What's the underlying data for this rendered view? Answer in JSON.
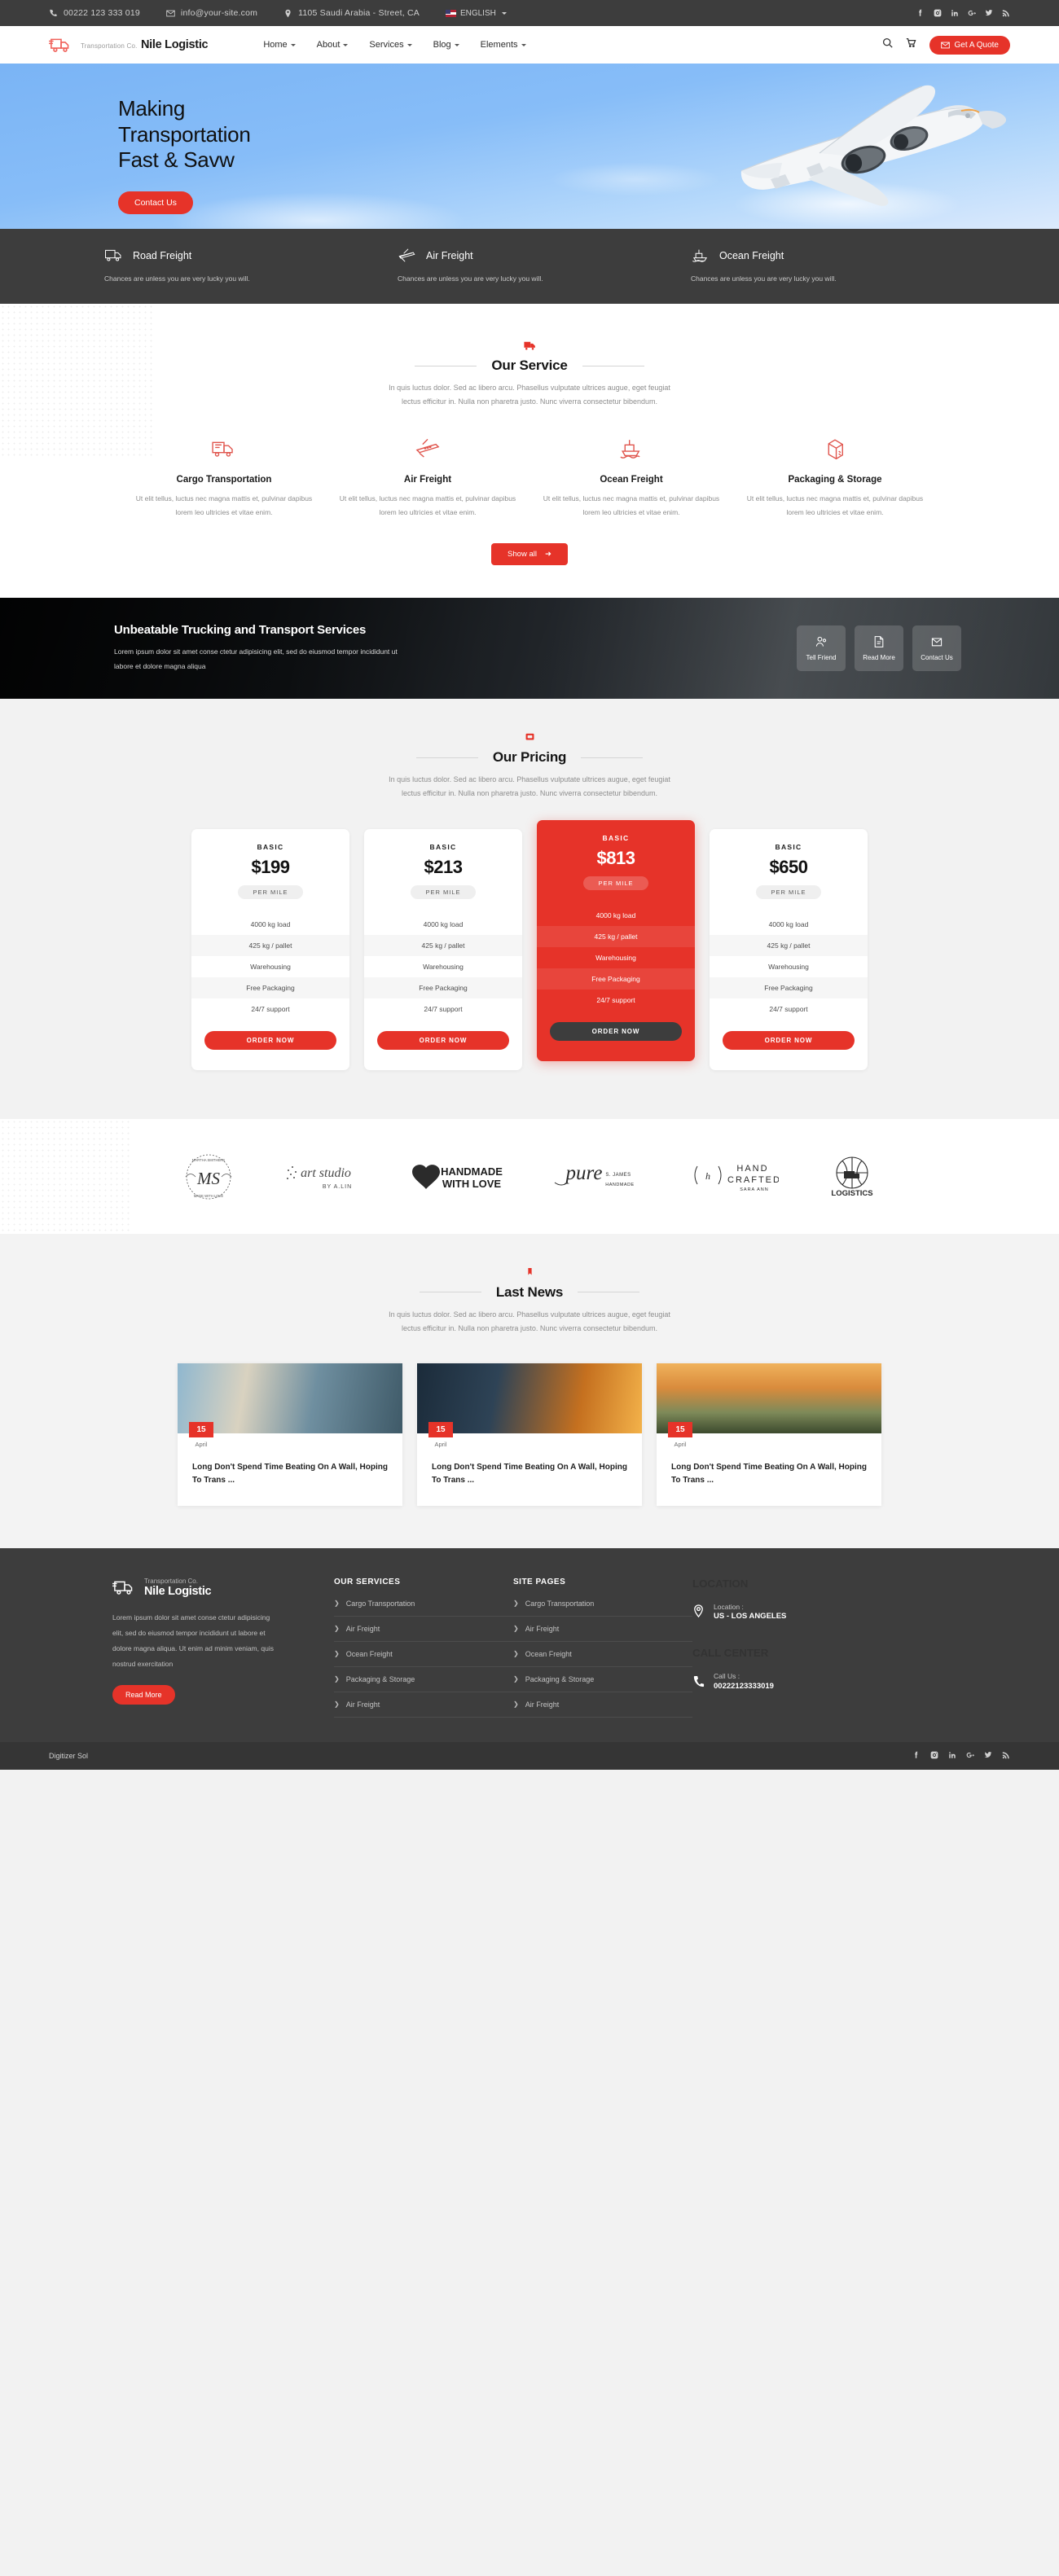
{
  "topbar": {
    "phone": "00222 123 333 019",
    "email": "info@your-site.com",
    "address": "1105 Saudi Arabia - Street, CA",
    "language": "ENGLISH"
  },
  "header": {
    "brand_sub": "Transportation Co.",
    "brand_name": "Nile Logistic",
    "nav": [
      {
        "label": "Home"
      },
      {
        "label": "About"
      },
      {
        "label": "Services"
      },
      {
        "label": "Blog"
      },
      {
        "label": "Elements"
      }
    ],
    "quote_button": "Get A Quote"
  },
  "hero": {
    "title_line1": "Making",
    "title_line2": "Transportation",
    "title_line3": "Fast & Savw",
    "button": "Contact Us"
  },
  "freight": [
    {
      "title": "Road Freight",
      "text": "Chances are unless you are very lucky you will.",
      "icon": "truck-icon"
    },
    {
      "title": "Air Freight",
      "text": "Chances are unless you are very lucky you will.",
      "icon": "plane-icon"
    },
    {
      "title": "Ocean Freight",
      "text": "Chances are unless you are very lucky you will.",
      "icon": "ship-icon"
    }
  ],
  "services_section": {
    "title": "Our Service",
    "subtitle_line1": "In quis luctus dolor. Sed ac libero arcu. Phasellus vulputate ultrices augue, eget feugiat",
    "subtitle_line2": "lectus efficitur in. Nulla non pharetra justo. Nunc viverra consectetur bibendum.",
    "show_all": "Show all",
    "items": [
      {
        "title": "Cargo Transportation",
        "text": "Ut elit tellus, luctus nec magna mattis et, pulvinar dapibus lorem leo ultricies et vitae enim.",
        "icon": "truck-icon"
      },
      {
        "title": "Air Freight",
        "text": "Ut elit tellus, luctus nec magna mattis et, pulvinar dapibus lorem leo ultricies et vitae enim.",
        "icon": "plane-icon"
      },
      {
        "title": "Ocean Freight",
        "text": "Ut elit tellus, luctus nec magna mattis et, pulvinar dapibus lorem leo ultricies et vitae enim.",
        "icon": "ship-icon"
      },
      {
        "title": "Packaging & Storage",
        "text": "Ut elit tellus, luctus nec magna mattis et, pulvinar dapibus lorem leo ultricies et vitae enim.",
        "icon": "box-icon"
      }
    ]
  },
  "cta": {
    "title": "Unbeatable Trucking and Transport Services",
    "text_line1": "Lorem ipsum dolor sit amet conse ctetur adipisicing elit, sed do eiusmod tempor incididunt ut",
    "text_line2": "labore et dolore magna aliqua",
    "boxes": [
      {
        "label": "Tell Friend",
        "icon": "users-icon"
      },
      {
        "label": "Read More",
        "icon": "document-icon"
      },
      {
        "label": "Contact Us",
        "icon": "envelope-icon"
      }
    ]
  },
  "pricing_section": {
    "title": "Our Pricing",
    "subtitle_line1": "In quis luctus dolor. Sed ac libero arcu. Phasellus vulputate ultrices augue, eget feugiat",
    "subtitle_line2": "lectus efficitur in. Nulla non pharetra justo. Nunc viverra consectetur bibendum.",
    "cards": [
      {
        "plan": "BASIC",
        "price": "$199",
        "per": "PER MILE",
        "features": [
          "4000 kg load",
          "425 kg / pallet",
          "Warehousing",
          "Free Packaging",
          "24/7 support"
        ],
        "button": "ORDER NOW",
        "featured": false
      },
      {
        "plan": "BASIC",
        "price": "$213",
        "per": "PER MILE",
        "features": [
          "4000 kg load",
          "425 kg / pallet",
          "Warehousing",
          "Free Packaging",
          "24/7 support"
        ],
        "button": "ORDER NOW",
        "featured": false
      },
      {
        "plan": "BASIC",
        "price": "$813",
        "per": "PER MILE",
        "features": [
          "4000 kg load",
          "425 kg / pallet",
          "Warehousing",
          "Free Packaging",
          "24/7 support"
        ],
        "button": "ORDER NOW",
        "featured": true
      },
      {
        "plan": "BASIC",
        "price": "$650",
        "per": "PER MILE",
        "features": [
          "4000 kg load",
          "425 kg / pallet",
          "Warehousing",
          "Free Packaging",
          "24/7 support"
        ],
        "button": "ORDER NOW",
        "featured": false
      }
    ]
  },
  "brands": [
    {
      "name": "MS Martha Smithers Made With Love"
    },
    {
      "name": "art studio BY A.LIN"
    },
    {
      "name": "HANDMADE WITH LOVE"
    },
    {
      "name": "pure S. JAMES HANDMADE"
    },
    {
      "name": "HAND CRAFTED SARA ANN"
    },
    {
      "name": "LOGISTICS"
    }
  ],
  "news_section": {
    "title": "Last News",
    "subtitle_line1": "In quis luctus dolor. Sed ac libero arcu. Phasellus vulputate ultrices augue, eget feugiat",
    "subtitle_line2": "lectus efficitur in. Nulla non pharetra justo. Nunc viverra consectetur bibendum.",
    "cards": [
      {
        "day": "15",
        "month": "April",
        "title": "Long Don't Spend Time Beating On A Wall, Hoping To Trans ..."
      },
      {
        "day": "15",
        "month": "April",
        "title": "Long Don't Spend Time Beating On A Wall, Hoping To Trans ..."
      },
      {
        "day": "15",
        "month": "April",
        "title": "Long Don't Spend Time Beating On A Wall, Hoping To Trans ..."
      }
    ]
  },
  "footer": {
    "brand_sub": "Transportation Co.",
    "brand_name": "Nile Logistic",
    "description": "Lorem ipsum dolor sit amet conse ctetur adipisicing elit, sed do eiusmod tempor incididunt ut labore et dolore magna aliqua. Ut enim ad minim veniam, quis nostrud exercitation",
    "read_more": "Read More",
    "services_title": "OUR SERVICES",
    "services": [
      "Cargo Transportation",
      "Air Freight",
      "Ocean Freight",
      "Packaging & Storage",
      "Air Freight"
    ],
    "pages_title": "SITE PAGES",
    "pages": [
      "Cargo Transportation",
      "Air Freight",
      "Ocean Freight",
      "Packaging & Storage",
      "Air Freight"
    ],
    "location_title": "LOCATION",
    "location_label": "Location :",
    "location_value": "US - LOS ANGELES",
    "call_title": "CALL CENTER",
    "call_label": "Call Us :",
    "call_value": "00222123333019"
  },
  "bottombar": {
    "copyright": "Digitizer Sol"
  },
  "colors": {
    "accent": "#e63329",
    "dark": "#3d3d3d",
    "light_bg": "#f2f2f2"
  }
}
